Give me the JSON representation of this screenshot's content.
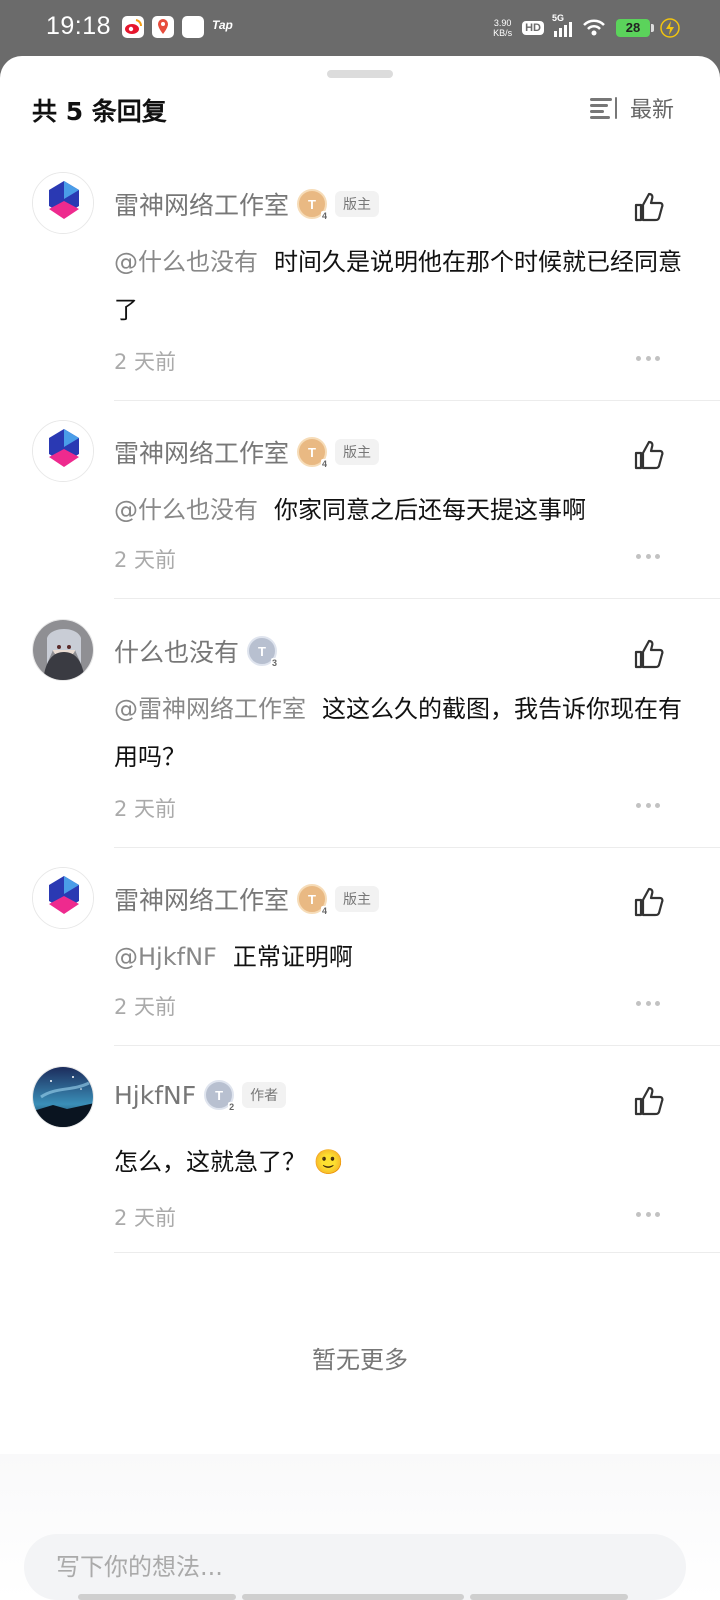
{
  "status_bar": {
    "time": "19:18",
    "tap_label": "Tap",
    "net_speed_value": "3.90",
    "net_speed_unit": "KB/s",
    "hd_label": "HD",
    "network_type": "5G",
    "battery": "28"
  },
  "header": {
    "title": "共 5 条回复",
    "sort_label": "最新"
  },
  "comments": [
    {
      "author": "雷神网络工作室",
      "level": "T",
      "level_num": "4",
      "badge": "版主",
      "mention": "@什么也没有",
      "text": "时间久是说明他在那个时候就已经同意了",
      "time": "2 天前"
    },
    {
      "author": "雷神网络工作室",
      "level": "T",
      "level_num": "4",
      "badge": "版主",
      "mention": "@什么也没有",
      "text": "你家同意之后还每天提这事啊",
      "time": "2 天前"
    },
    {
      "author": "什么也没有",
      "level": "T",
      "level_num": "3",
      "badge": "",
      "mention": "@雷神网络工作室",
      "text": "这这么久的截图，我告诉你现在有用吗？",
      "time": "2 天前"
    },
    {
      "author": "雷神网络工作室",
      "level": "T",
      "level_num": "4",
      "badge": "版主",
      "mention": "@HjkfNF",
      "text": "正常证明啊",
      "time": "2 天前"
    },
    {
      "author": "HjkfNF",
      "level": "T",
      "level_num": "2",
      "badge": "作者",
      "mention": "",
      "text": "怎么，这就急了？",
      "emoji": "🙂",
      "time": "2 天前"
    }
  ],
  "footer": {
    "no_more": "暂无更多",
    "input_placeholder": "写下你的想法..."
  }
}
